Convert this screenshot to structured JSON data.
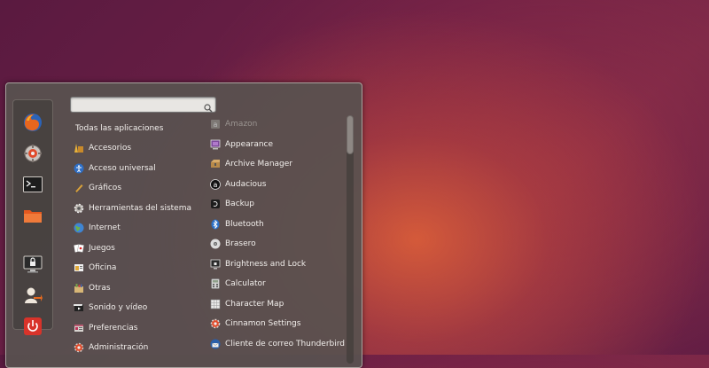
{
  "search": {
    "value": "",
    "placeholder": ""
  },
  "categories": {
    "all_label": "Todas las aplicaciones",
    "items": [
      {
        "label": "Accesorios",
        "icon": "accessories-icon"
      },
      {
        "label": "Acceso universal",
        "icon": "universal-access-icon"
      },
      {
        "label": "Gráficos",
        "icon": "graphics-icon"
      },
      {
        "label": "Herramientas del sistema",
        "icon": "system-tools-icon"
      },
      {
        "label": "Internet",
        "icon": "internet-icon"
      },
      {
        "label": "Juegos",
        "icon": "games-icon"
      },
      {
        "label": "Oficina",
        "icon": "office-icon"
      },
      {
        "label": "Otras",
        "icon": "other-icon"
      },
      {
        "label": "Sonido y vídeo",
        "icon": "sound-video-icon"
      },
      {
        "label": "Preferencias",
        "icon": "preferences-icon"
      },
      {
        "label": "Administración",
        "icon": "administration-icon"
      }
    ]
  },
  "apps": [
    {
      "label": "Amazon",
      "icon": "amazon-icon",
      "dimmed": true
    },
    {
      "label": "Appearance",
      "icon": "appearance-icon"
    },
    {
      "label": "Archive Manager",
      "icon": "archive-manager-icon"
    },
    {
      "label": "Audacious",
      "icon": "audacious-icon"
    },
    {
      "label": "Backup",
      "icon": "backup-icon"
    },
    {
      "label": "Bluetooth",
      "icon": "bluetooth-icon"
    },
    {
      "label": "Brasero",
      "icon": "brasero-icon"
    },
    {
      "label": "Brightness and Lock",
      "icon": "brightness-lock-icon"
    },
    {
      "label": "Calculator",
      "icon": "calculator-icon"
    },
    {
      "label": "Character Map",
      "icon": "character-map-icon"
    },
    {
      "label": "Cinnamon Settings",
      "icon": "cinnamon-settings-icon"
    },
    {
      "label": "Cliente de correo Thunderbird",
      "icon": "thunderbird-icon"
    }
  ],
  "favorites": [
    {
      "name": "firefox-icon"
    },
    {
      "name": "settings-icon"
    },
    {
      "name": "terminal-icon"
    },
    {
      "name": "files-icon"
    },
    {
      "name": "lock-screen-icon"
    },
    {
      "name": "logout-icon"
    },
    {
      "name": "power-icon"
    }
  ],
  "colors": {
    "menu_bg": "#58524f",
    "text": "#f2efec",
    "dim_text": "#9a9490",
    "power_red": "#d8332a"
  }
}
